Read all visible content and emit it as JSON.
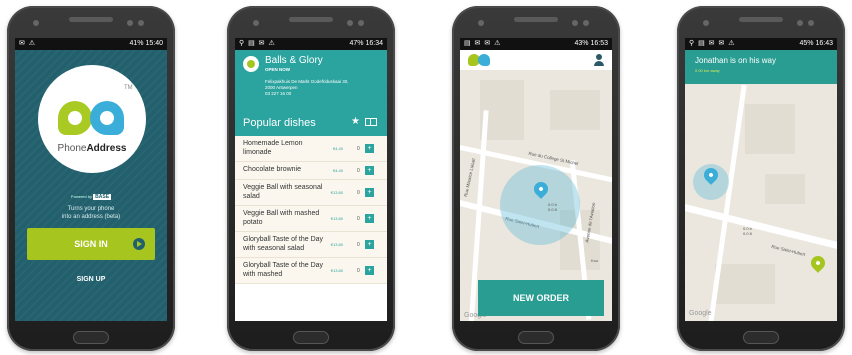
{
  "screens": {
    "signin": {
      "status": {
        "left": "✉ ⚠",
        "right": "41% 15:40"
      },
      "logo": {
        "trademark": "TM",
        "name_light": "Phone",
        "name_bold": "Address"
      },
      "powered_by": "Powered by",
      "powered_brand": "BASE",
      "tagline_line1": "Turns your phone",
      "tagline_line2": "into an address (beta)",
      "signin_label": "SIGN IN",
      "signup_label": "SIGN UP"
    },
    "menu": {
      "status": {
        "left": "⚲ ▤ ✉ ⚠",
        "right": "47% 16:34"
      },
      "restaurant": {
        "name": "Balls & Glory",
        "open": "OPEN NOW",
        "address1": "Felixpakhuis De Markt Godefriduskaai 30,",
        "address2": "2000 Antwerpen",
        "phone": "03 227 16 00"
      },
      "section_title": "Popular dishes",
      "dishes": [
        {
          "name": "Homemade Lemon limonade",
          "price": "€4.40",
          "qty": "0",
          "add": "+"
        },
        {
          "name": "Chocolate brownie",
          "price": "€4.40",
          "qty": "0",
          "add": "+"
        },
        {
          "name": "Veggie Ball with seasonal salad",
          "price": "€13.80",
          "qty": "0",
          "add": "+"
        },
        {
          "name": "Veggie Ball with mashed potato",
          "price": "€13.80",
          "qty": "0",
          "add": "+"
        },
        {
          "name": "Gloryball Taste of the Day with seasonal salad",
          "price": "€13.80",
          "qty": "0",
          "add": "+"
        },
        {
          "name": "Gloryball Taste of the Day with mashed",
          "price": "€13.80",
          "qty": "0",
          "add": "+"
        }
      ]
    },
    "order": {
      "status": {
        "left": "▤ ✉ ✉ ⚠",
        "right": "43% 16:53"
      },
      "streets": {
        "college": "Rue du College St Michel",
        "saint_hubert": "Rue Saint-Hubert",
        "maurice": "Rue Maurice Liétart",
        "aviation": "Avenue de l'Aviation"
      },
      "house_label": "0.0 b",
      "house_label2": "0.0 8",
      "poi_label": "Koo",
      "google": "Google",
      "new_order_label": "NEW ORDER"
    },
    "tracking": {
      "status": {
        "left": "⚲ ▤ ✉ ✉ ⚠",
        "right": "45% 16:43"
      },
      "banner_title": "Jonathan is on his way",
      "banner_sub": "0.00 km away",
      "street": "Rue Saint-Hubert",
      "house_label": "0.0 b",
      "house_label2": "0.0 8",
      "google": "Google"
    }
  },
  "colors": {
    "teal_dark": "#23606d",
    "teal": "#2ba39e",
    "lime": "#a6c51f",
    "blue": "#3aaed8"
  }
}
